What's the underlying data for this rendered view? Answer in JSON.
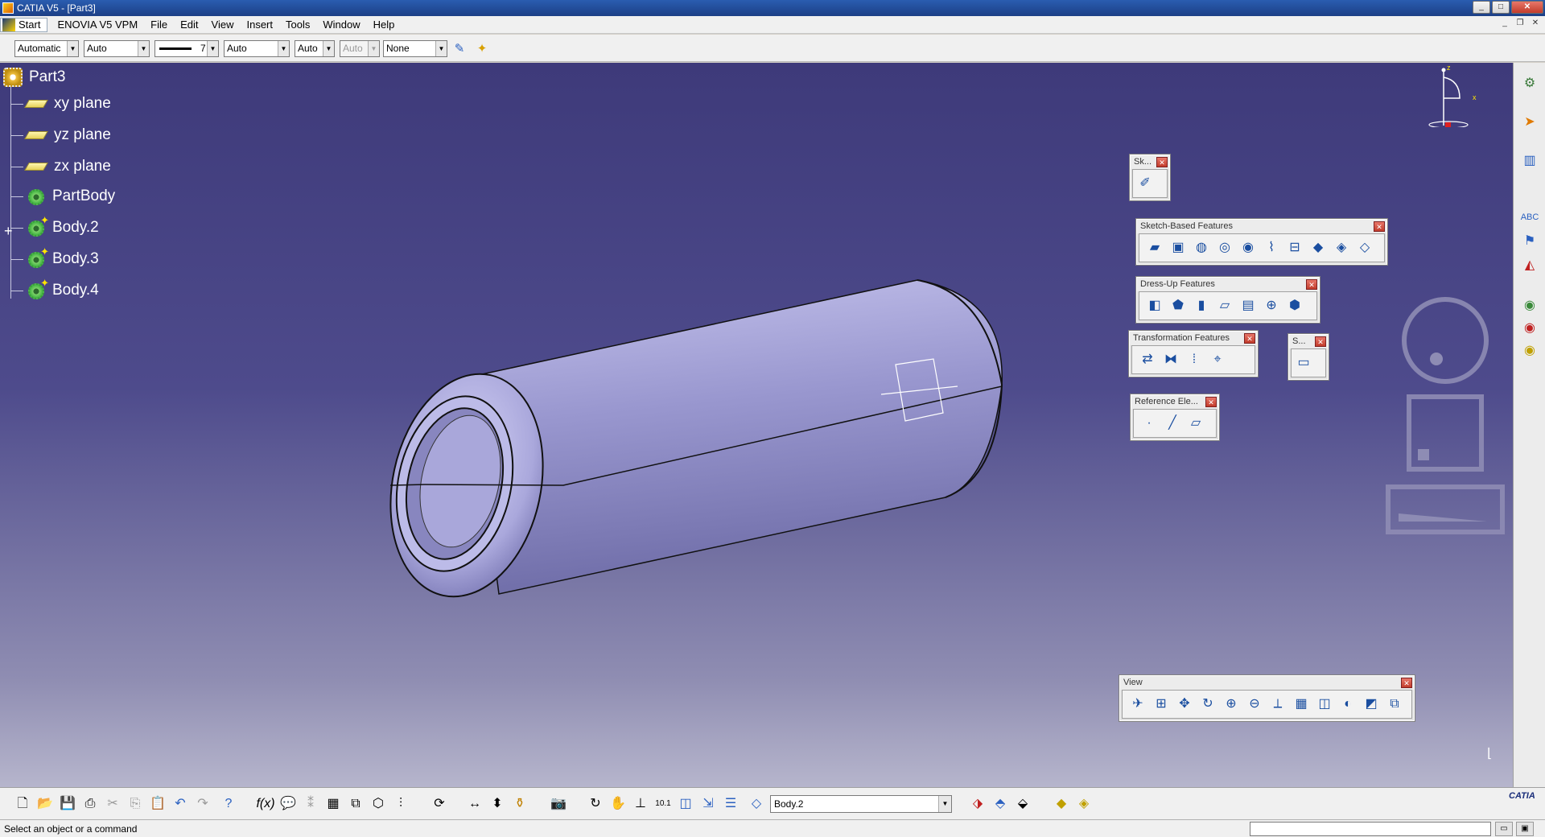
{
  "window": {
    "title": "CATIA V5 - [Part3]",
    "min": "_",
    "max": "□",
    "close": "✕"
  },
  "menu": {
    "items": [
      "Start",
      "ENOVIA V5 VPM",
      "File",
      "Edit",
      "View",
      "Insert",
      "Tools",
      "Window",
      "Help"
    ]
  },
  "properties_bar": {
    "color": "Automatic",
    "transparency": "Auto",
    "line_weight": "7",
    "line_type": "Auto",
    "point_symbol": "Auto",
    "rendering": "Auto",
    "layer": "None"
  },
  "tree": {
    "root": "Part3",
    "nodes": [
      "xy plane",
      "yz plane",
      "zx plane",
      "PartBody",
      "Body.2",
      "Body.3",
      "Body.4"
    ],
    "expander": "+"
  },
  "toolbars": {
    "sketcher": {
      "title": "Sk..."
    },
    "sketch_based": {
      "title": "Sketch-Based Features"
    },
    "dress_up": {
      "title": "Dress-Up Features"
    },
    "transformation": {
      "title": "Transformation Features"
    },
    "surface": {
      "title": "S..."
    },
    "reference": {
      "title": "Reference Ele..."
    },
    "view": {
      "title": "View"
    }
  },
  "current_body": "Body.2",
  "status": {
    "message": "Select an object or a command"
  },
  "compass": {
    "x_label": "x",
    "z_label": "z"
  },
  "brand": "CATIA",
  "colors": {
    "viewport_top": "#3e3a7a",
    "viewport_bottom": "#b6b5cc",
    "part_surface": "#8a88c0"
  }
}
